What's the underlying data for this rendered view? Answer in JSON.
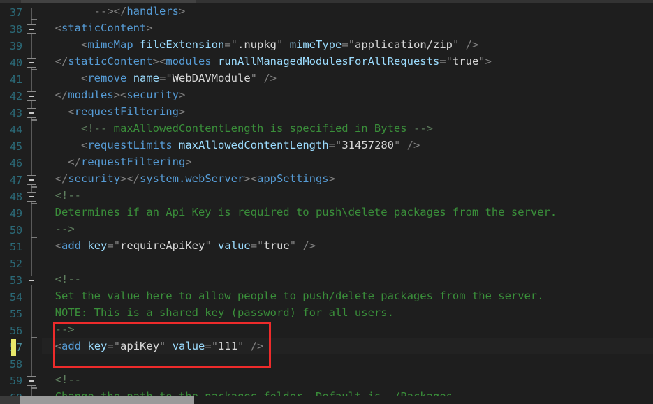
{
  "editor": {
    "language": "xml",
    "theme": "dark",
    "first_line_number": 37,
    "current_line": 57,
    "colors": {
      "background": "#1e1e1e",
      "line_number": "#2b6a78",
      "tag": "#569cd6",
      "attribute": "#9cdcfe",
      "value": "#d8d8d8",
      "comment": "#3a8f3a",
      "punctuation": "#808080",
      "annotation_box": "#ee2b2b",
      "change_marker": "#e8e86a"
    }
  },
  "lines": [
    {
      "num": "37",
      "indent": 0,
      "tokens": [
        {
          "t": "        ",
          "c": "t-val"
        },
        {
          "t": "-->",
          "c": "t-punct"
        },
        {
          "t": "</",
          "c": "t-punct"
        },
        {
          "t": "handlers",
          "c": "t-tag"
        },
        {
          "t": ">",
          "c": "t-punct"
        }
      ]
    },
    {
      "num": "38",
      "indent": 0,
      "tokens": [
        {
          "t": "  ",
          "c": "t-val"
        },
        {
          "t": "<",
          "c": "t-punct"
        },
        {
          "t": "staticContent",
          "c": "t-tag"
        },
        {
          "t": ">",
          "c": "t-punct"
        }
      ]
    },
    {
      "num": "39",
      "indent": 0,
      "tokens": [
        {
          "t": "      ",
          "c": "t-val"
        },
        {
          "t": "<",
          "c": "t-punct"
        },
        {
          "t": "mimeMap",
          "c": "t-tag"
        },
        {
          "t": " ",
          "c": "t-val"
        },
        {
          "t": "fileExtension",
          "c": "t-attr"
        },
        {
          "t": "=\"",
          "c": "t-punct"
        },
        {
          "t": ".nupkg",
          "c": "t-val"
        },
        {
          "t": "\" ",
          "c": "t-punct"
        },
        {
          "t": "mimeType",
          "c": "t-attr"
        },
        {
          "t": "=\"",
          "c": "t-punct"
        },
        {
          "t": "application/zip",
          "c": "t-val"
        },
        {
          "t": "\" />",
          "c": "t-punct"
        }
      ]
    },
    {
      "num": "40",
      "indent": 0,
      "tokens": [
        {
          "t": "  ",
          "c": "t-val"
        },
        {
          "t": "</",
          "c": "t-punct"
        },
        {
          "t": "staticContent",
          "c": "t-tag"
        },
        {
          "t": "><",
          "c": "t-punct"
        },
        {
          "t": "modules",
          "c": "t-tag"
        },
        {
          "t": " ",
          "c": "t-val"
        },
        {
          "t": "runAllManagedModulesForAllRequests",
          "c": "t-attr"
        },
        {
          "t": "=\"",
          "c": "t-punct"
        },
        {
          "t": "true",
          "c": "t-val"
        },
        {
          "t": "\">",
          "c": "t-punct"
        }
      ]
    },
    {
      "num": "41",
      "indent": 0,
      "tokens": [
        {
          "t": "      ",
          "c": "t-val"
        },
        {
          "t": "<",
          "c": "t-punct"
        },
        {
          "t": "remove",
          "c": "t-tag"
        },
        {
          "t": " ",
          "c": "t-val"
        },
        {
          "t": "name",
          "c": "t-attr"
        },
        {
          "t": "=\"",
          "c": "t-punct"
        },
        {
          "t": "WebDAVModule",
          "c": "t-val"
        },
        {
          "t": "\" />",
          "c": "t-punct"
        }
      ]
    },
    {
      "num": "42",
      "indent": 0,
      "tokens": [
        {
          "t": "  ",
          "c": "t-val"
        },
        {
          "t": "</",
          "c": "t-punct"
        },
        {
          "t": "modules",
          "c": "t-tag"
        },
        {
          "t": "><",
          "c": "t-punct"
        },
        {
          "t": "security",
          "c": "t-tag"
        },
        {
          "t": ">",
          "c": "t-punct"
        }
      ]
    },
    {
      "num": "43",
      "indent": 0,
      "tokens": [
        {
          "t": "    ",
          "c": "t-val"
        },
        {
          "t": "<",
          "c": "t-punct"
        },
        {
          "t": "requestFiltering",
          "c": "t-tag"
        },
        {
          "t": ">",
          "c": "t-punct"
        }
      ]
    },
    {
      "num": "44",
      "indent": 0,
      "tokens": [
        {
          "t": "      ",
          "c": "t-val"
        },
        {
          "t": "<!--",
          "c": "t-cmark"
        },
        {
          "t": " maxAllowedContentLength is specified in Bytes ",
          "c": "t-comment"
        },
        {
          "t": "-->",
          "c": "t-cmark"
        }
      ]
    },
    {
      "num": "45",
      "indent": 0,
      "tokens": [
        {
          "t": "      ",
          "c": "t-val"
        },
        {
          "t": "<",
          "c": "t-punct"
        },
        {
          "t": "requestLimits",
          "c": "t-tag"
        },
        {
          "t": " ",
          "c": "t-val"
        },
        {
          "t": "maxAllowedContentLength",
          "c": "t-attr"
        },
        {
          "t": "=\"",
          "c": "t-punct"
        },
        {
          "t": "31457280",
          "c": "t-val"
        },
        {
          "t": "\" />",
          "c": "t-punct"
        }
      ]
    },
    {
      "num": "46",
      "indent": 0,
      "tokens": [
        {
          "t": "    ",
          "c": "t-val"
        },
        {
          "t": "</",
          "c": "t-punct"
        },
        {
          "t": "requestFiltering",
          "c": "t-tag"
        },
        {
          "t": ">",
          "c": "t-punct"
        }
      ]
    },
    {
      "num": "47",
      "indent": 0,
      "tokens": [
        {
          "t": "  ",
          "c": "t-val"
        },
        {
          "t": "</",
          "c": "t-punct"
        },
        {
          "t": "security",
          "c": "t-tag"
        },
        {
          "t": "></",
          "c": "t-punct"
        },
        {
          "t": "system.webServer",
          "c": "t-tag"
        },
        {
          "t": "><",
          "c": "t-punct"
        },
        {
          "t": "appSettings",
          "c": "t-tag"
        },
        {
          "t": ">",
          "c": "t-punct"
        }
      ]
    },
    {
      "num": "48",
      "indent": 0,
      "tokens": [
        {
          "t": "  ",
          "c": "t-val"
        },
        {
          "t": "<!--",
          "c": "t-cmark"
        }
      ]
    },
    {
      "num": "49",
      "indent": 0,
      "tokens": [
        {
          "t": "  ",
          "c": "t-val"
        },
        {
          "t": "Determines if an Api Key is required to push\\delete packages from the server.",
          "c": "t-comment"
        }
      ]
    },
    {
      "num": "50",
      "indent": 0,
      "tokens": [
        {
          "t": "  ",
          "c": "t-val"
        },
        {
          "t": "-->",
          "c": "t-cmark"
        }
      ]
    },
    {
      "num": "51",
      "indent": 0,
      "tokens": [
        {
          "t": "  ",
          "c": "t-val"
        },
        {
          "t": "<",
          "c": "t-punct"
        },
        {
          "t": "add",
          "c": "t-tag"
        },
        {
          "t": " ",
          "c": "t-val"
        },
        {
          "t": "key",
          "c": "t-attr"
        },
        {
          "t": "=\"",
          "c": "t-punct"
        },
        {
          "t": "requireApiKey",
          "c": "t-val"
        },
        {
          "t": "\" ",
          "c": "t-punct"
        },
        {
          "t": "value",
          "c": "t-attr"
        },
        {
          "t": "=\"",
          "c": "t-punct"
        },
        {
          "t": "true",
          "c": "t-val"
        },
        {
          "t": "\" />",
          "c": "t-punct"
        }
      ]
    },
    {
      "num": "52",
      "indent": 0,
      "tokens": []
    },
    {
      "num": "53",
      "indent": 0,
      "tokens": [
        {
          "t": "  ",
          "c": "t-val"
        },
        {
          "t": "<!--",
          "c": "t-cmark"
        }
      ]
    },
    {
      "num": "54",
      "indent": 0,
      "tokens": [
        {
          "t": "  ",
          "c": "t-val"
        },
        {
          "t": "Set the value here to allow people to push/delete packages from the server.",
          "c": "t-comment"
        }
      ]
    },
    {
      "num": "55",
      "indent": 0,
      "tokens": [
        {
          "t": "  ",
          "c": "t-val"
        },
        {
          "t": "NOTE: This is a shared key (password) for all users.",
          "c": "t-comment"
        }
      ]
    },
    {
      "num": "56",
      "indent": 0,
      "tokens": [
        {
          "t": "  ",
          "c": "t-val"
        },
        {
          "t": "-->",
          "c": "t-cmark"
        }
      ]
    },
    {
      "num": "57",
      "indent": 0,
      "current": true,
      "tokens": [
        {
          "t": "  ",
          "c": "t-val"
        },
        {
          "t": "<",
          "c": "t-punct"
        },
        {
          "t": "add",
          "c": "t-tag"
        },
        {
          "t": " ",
          "c": "t-val"
        },
        {
          "t": "key",
          "c": "t-attr"
        },
        {
          "t": "=\"",
          "c": "t-punct"
        },
        {
          "t": "apiKey",
          "c": "t-val"
        },
        {
          "t": "\" ",
          "c": "t-punct"
        },
        {
          "t": "value",
          "c": "t-attr"
        },
        {
          "t": "=\"",
          "c": "t-punct"
        },
        {
          "t": "111",
          "c": "t-val"
        },
        {
          "t": "\" />",
          "c": "t-punct"
        }
      ]
    },
    {
      "num": "58",
      "indent": 0,
      "tokens": []
    },
    {
      "num": "59",
      "indent": 0,
      "tokens": [
        {
          "t": "  ",
          "c": "t-val"
        },
        {
          "t": "<!--",
          "c": "t-cmark"
        }
      ]
    },
    {
      "num": "60",
      "indent": 0,
      "tokens": [
        {
          "t": "  ",
          "c": "t-val"
        },
        {
          "t": "Change the path to the packages folder. Default is ~/Packages.",
          "c": "t-comment"
        }
      ]
    }
  ],
  "fold_markers": [
    38,
    40,
    42,
    43,
    47,
    48,
    53,
    59
  ],
  "fold_ticks": [
    37,
    40,
    43,
    47,
    48,
    50,
    56,
    59
  ],
  "change_markers": [
    57
  ],
  "annotation": {
    "type": "red-rectangle",
    "target_line": 57,
    "target_text": "<add key=\"apiKey\" value=\"111\" />"
  },
  "scrollbar": {
    "orientation": "horizontal",
    "position": "bottom"
  }
}
